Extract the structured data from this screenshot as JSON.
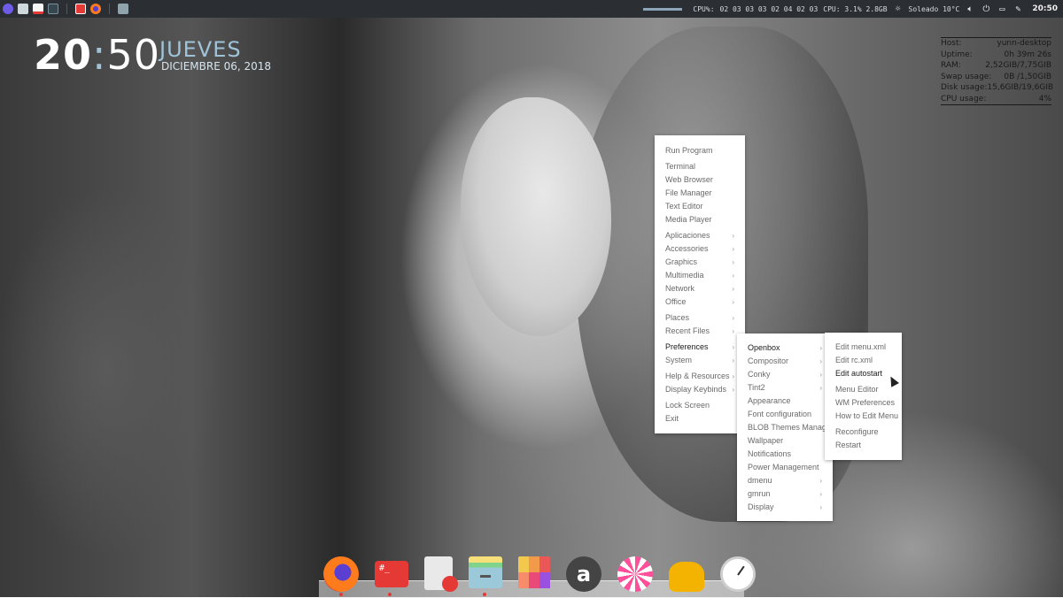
{
  "panel": {
    "launchers": [
      "menu-icon",
      "file-manager-icon",
      "text-editor-icon",
      "terminal-icon",
      "task-manager-icon",
      "firefox-icon",
      "home-folder-icon"
    ],
    "cpu_label": "CPU%:",
    "cpu_cores": "02 03 03 03 02 04 02 03",
    "cpu_total": "CPU: 3.1% 2.8GB",
    "weather": "Soleado 10°C",
    "time": "20:50"
  },
  "clock": {
    "hour": "20",
    "minute": "50",
    "day": "JUEVES",
    "date": "DICIEMBRE 06, 2018"
  },
  "sysinfo": {
    "rows": [
      {
        "label": "Host:",
        "value": "yunn-desktop"
      },
      {
        "label": "Uptime:",
        "value": "0h 39m 26s"
      },
      {
        "label": "RAM:",
        "value": "2,52GIB/7,75GIB"
      },
      {
        "label": "Swap usage:",
        "value": "0B  /1,50GIB"
      },
      {
        "label": "Disk usage:",
        "value": "15,6GIB/19,6GIB"
      },
      {
        "label": "CPU usage:",
        "value": "4%"
      }
    ]
  },
  "menu_main": {
    "items": [
      {
        "label": "Run Program"
      },
      {
        "label": "Terminal"
      },
      {
        "label": "Web Browser"
      },
      {
        "label": "File Manager"
      },
      {
        "label": "Text Editor"
      },
      {
        "label": "Media Player"
      },
      {
        "label": "Aplicaciones"
      },
      {
        "label": "Accessories"
      },
      {
        "label": "Graphics"
      },
      {
        "label": "Multimedia"
      },
      {
        "label": "Network"
      },
      {
        "label": "Office"
      },
      {
        "label": "Places"
      },
      {
        "label": "Recent Files"
      },
      {
        "label": "Preferences"
      },
      {
        "label": "System"
      },
      {
        "label": "Help & Resources"
      },
      {
        "label": "Display Keybinds"
      },
      {
        "label": "Lock Screen"
      },
      {
        "label": "Exit"
      }
    ]
  },
  "menu_prefs": {
    "items": [
      {
        "label": "Openbox"
      },
      {
        "label": "Compositor"
      },
      {
        "label": "Conky"
      },
      {
        "label": "Tint2"
      },
      {
        "label": "Appearance"
      },
      {
        "label": "Font configuration"
      },
      {
        "label": "BLOB Themes Manager"
      },
      {
        "label": "Wallpaper"
      },
      {
        "label": "Notifications"
      },
      {
        "label": "Power Management"
      },
      {
        "label": "dmenu"
      },
      {
        "label": "gmrun"
      },
      {
        "label": "Display"
      }
    ]
  },
  "menu_openbox": {
    "items": [
      {
        "label": "Edit menu.xml"
      },
      {
        "label": "Edit rc.xml"
      },
      {
        "label": "Edit autostart"
      },
      {
        "label": "Menu Editor"
      },
      {
        "label": "WM Preferences"
      },
      {
        "label": "How to Edit Menu"
      },
      {
        "label": "Reconfigure"
      },
      {
        "label": "Restart"
      }
    ]
  },
  "dock": {
    "apps": [
      "firefox-icon",
      "terminal-icon",
      "text-editor-icon",
      "file-manager-icon",
      "palette-icon",
      "amazon-icon",
      "candy-icon",
      "teapot-icon",
      "clock-icon"
    ],
    "terminal_glyph": "#_",
    "amazon_glyph": "a"
  },
  "colors": {
    "accent": "#9fc3d8",
    "panel_bg": "#2b2e33",
    "menu_bg": "#ffffff"
  }
}
